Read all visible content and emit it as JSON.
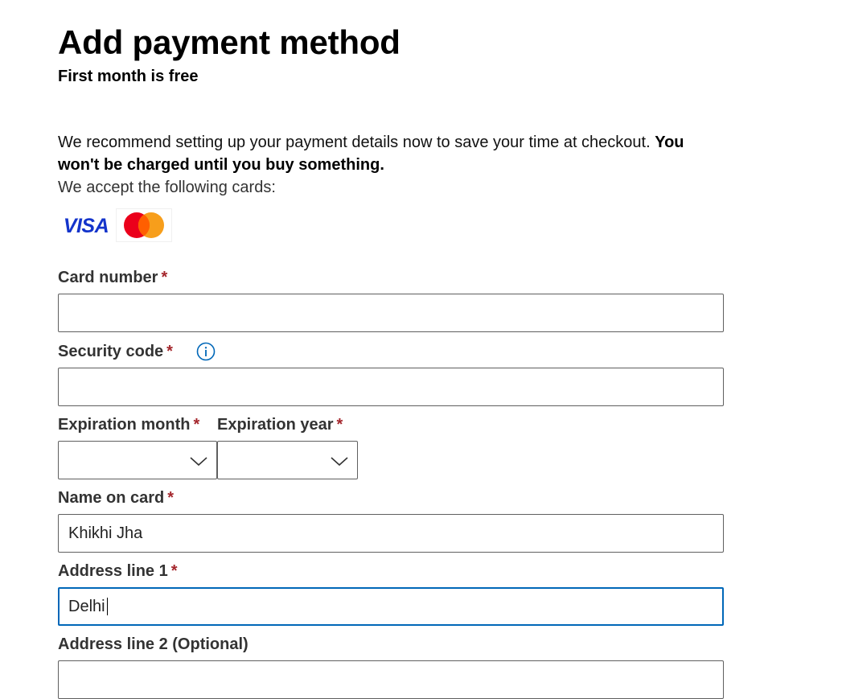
{
  "header": {
    "title": "Add payment method",
    "subtitle": "First month is free"
  },
  "intro": {
    "text": "We recommend setting up your payment details now to save your time at checkout.",
    "bold_text": "You won't be charged until you buy something.",
    "accepted_cards_label": "We accept the following cards:"
  },
  "accepted_cards": [
    {
      "name": "VISA",
      "icon": "visa-logo"
    },
    {
      "name": "Mastercard",
      "icon": "mastercard-logo"
    }
  ],
  "form": {
    "required_marker": "*",
    "card_number": {
      "label": "Card number",
      "value": ""
    },
    "security_code": {
      "label": "Security code",
      "value": "",
      "info_icon": "info-icon"
    },
    "expiration_month": {
      "label": "Expiration month",
      "value": ""
    },
    "expiration_year": {
      "label": "Expiration year",
      "value": ""
    },
    "name_on_card": {
      "label": "Name on card",
      "value": "Khikhi Jha"
    },
    "address_line_1": {
      "label": "Address line 1",
      "value": "Delhi"
    },
    "address_line_2": {
      "label": "Address line 2 (Optional)",
      "value": ""
    }
  },
  "colors": {
    "required": "#a4262c",
    "focus_border": "#0067b8",
    "info_icon": "#0067b8",
    "visa_blue": "#1434cb",
    "mastercard_red": "#eb001b",
    "mastercard_orange": "#f79e1b"
  }
}
